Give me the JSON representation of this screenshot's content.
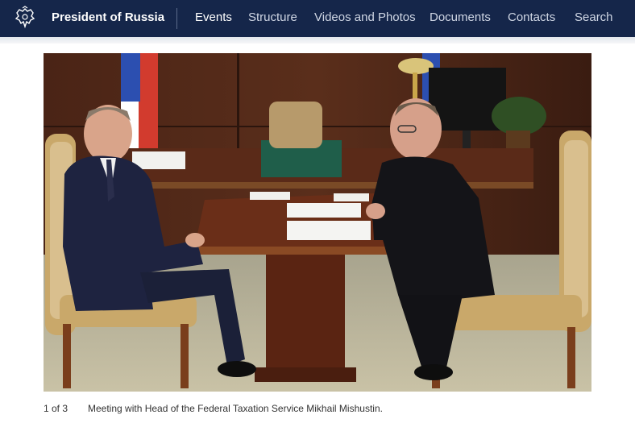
{
  "header": {
    "site_title": "President of Russia",
    "nav": [
      {
        "label": "Events",
        "active": true
      },
      {
        "label": "Structure",
        "active": false
      },
      {
        "label": "Videos and Photos",
        "active": false
      },
      {
        "label": "Documents",
        "active": false
      },
      {
        "label": "Contacts",
        "active": false
      },
      {
        "label": "Search",
        "active": false
      }
    ],
    "emblem_icon": "double-headed-eagle-emblem"
  },
  "photo": {
    "counter": "1 of 3",
    "caption": "Meeting with Head of the Federal Taxation Service Mikhail Mishustin."
  },
  "colors": {
    "header_bg": "#15264a",
    "nav_active": "#ffffff",
    "nav_inactive": "#cfd6e4",
    "caption_text": "#333333"
  }
}
